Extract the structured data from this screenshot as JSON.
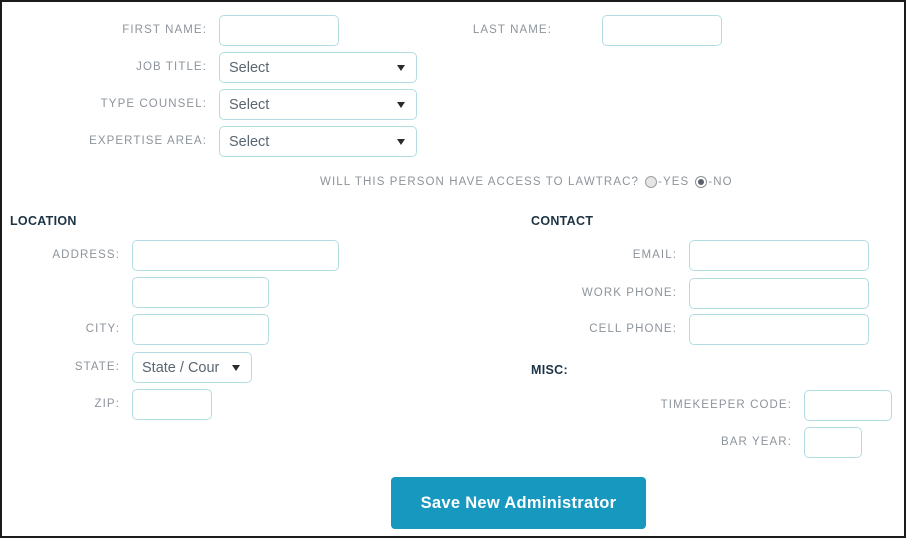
{
  "form": {
    "top_fields": [
      {
        "label": "FIRST NAME:",
        "value": "",
        "placeholder": ""
      },
      {
        "label": "LAST NAME:",
        "value": "",
        "placeholder": ""
      }
    ],
    "dropdowns": [
      {
        "label": "JOB TITLE:",
        "value": "Select"
      },
      {
        "label": "TYPE COUNSEL:",
        "value": "Select"
      },
      {
        "label": "EXPERTISE AREA:",
        "value": "Select"
      }
    ],
    "access_question": {
      "question": "WILL THIS PERSON HAVE ACCESS TO LAWTRAC?",
      "yes_label": "-YES",
      "no_label": "-NO",
      "selected": "no"
    },
    "location": {
      "heading": "LOCATION",
      "address_label": "ADDRESS:",
      "address_value": "",
      "address2_value": "",
      "city_label": "CITY:",
      "city_value": "",
      "state_label": "STATE:",
      "state_value": "State / Cour",
      "zip_label": "ZIP:",
      "zip_value": ""
    },
    "contact": {
      "heading": "CONTACT",
      "email_label": "EMAIL:",
      "email_value": "",
      "work_phone_label": "WORK PHONE:",
      "work_phone_value": "",
      "cell_phone_label": "CELL PHONE:",
      "cell_phone_value": ""
    },
    "misc": {
      "heading": "MISC:",
      "timekeeper_label": "TIMEKEEPER CODE:",
      "timekeeper_value": "",
      "bar_year_label": "BAR YEAR:",
      "bar_year_value": ""
    },
    "save_label": "Save New Administrator"
  },
  "colors": {
    "accent": "#1799bf",
    "field_border": "#b4dde3",
    "label_text": "#8d949b",
    "heading_text": "#1c3344",
    "value_text": "#5a6670"
  }
}
